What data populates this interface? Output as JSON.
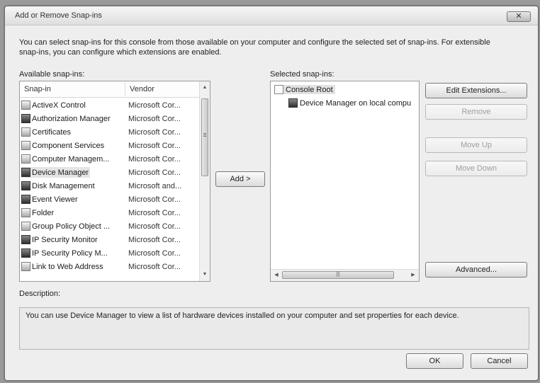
{
  "window": {
    "title": "Add or Remove Snap-ins",
    "close_glyph": "✕"
  },
  "intro": "You can select snap-ins for this console from those available on your computer and configure the selected set of snap-ins. For extensible snap-ins, you can configure which extensions are enabled.",
  "available": {
    "label": "Available snap-ins:",
    "columns": {
      "snapin": "Snap-in",
      "vendor": "Vendor"
    },
    "items": [
      {
        "name": "ActiveX Control",
        "vendor": "Microsoft Cor...",
        "icon": "activex-icon"
      },
      {
        "name": "Authorization Manager",
        "vendor": "Microsoft Cor...",
        "icon": "authorization-icon"
      },
      {
        "name": "Certificates",
        "vendor": "Microsoft Cor...",
        "icon": "certificates-icon"
      },
      {
        "name": "Component Services",
        "vendor": "Microsoft Cor...",
        "icon": "component-services-icon"
      },
      {
        "name": "Computer Managem...",
        "vendor": "Microsoft Cor...",
        "icon": "computer-management-icon"
      },
      {
        "name": "Device Manager",
        "vendor": "Microsoft Cor...",
        "icon": "device-manager-icon",
        "selected": true
      },
      {
        "name": "Disk Management",
        "vendor": "Microsoft and...",
        "icon": "disk-management-icon"
      },
      {
        "name": "Event Viewer",
        "vendor": "Microsoft Cor...",
        "icon": "event-viewer-icon"
      },
      {
        "name": "Folder",
        "vendor": "Microsoft Cor...",
        "icon": "folder-icon"
      },
      {
        "name": "Group Policy Object ...",
        "vendor": "Microsoft Cor...",
        "icon": "group-policy-icon"
      },
      {
        "name": "IP Security Monitor",
        "vendor": "Microsoft Cor...",
        "icon": "ip-security-monitor-icon"
      },
      {
        "name": "IP Security Policy M...",
        "vendor": "Microsoft Cor...",
        "icon": "ip-security-policy-icon"
      },
      {
        "name": "Link to Web Address",
        "vendor": "Microsoft Cor...",
        "icon": "web-link-icon"
      }
    ]
  },
  "add_button": "Add >",
  "selected": {
    "label": "Selected snap-ins:",
    "root": "Console Root",
    "child": "Device Manager on local compu"
  },
  "buttons": {
    "edit_extensions": "Edit Extensions...",
    "remove": "Remove",
    "move_up": "Move Up",
    "move_down": "Move Down",
    "advanced": "Advanced...",
    "ok": "OK",
    "cancel": "Cancel"
  },
  "description": {
    "label": "Description:",
    "text": "You can use Device Manager to view a list of hardware devices installed on your computer and set properties for each device."
  }
}
